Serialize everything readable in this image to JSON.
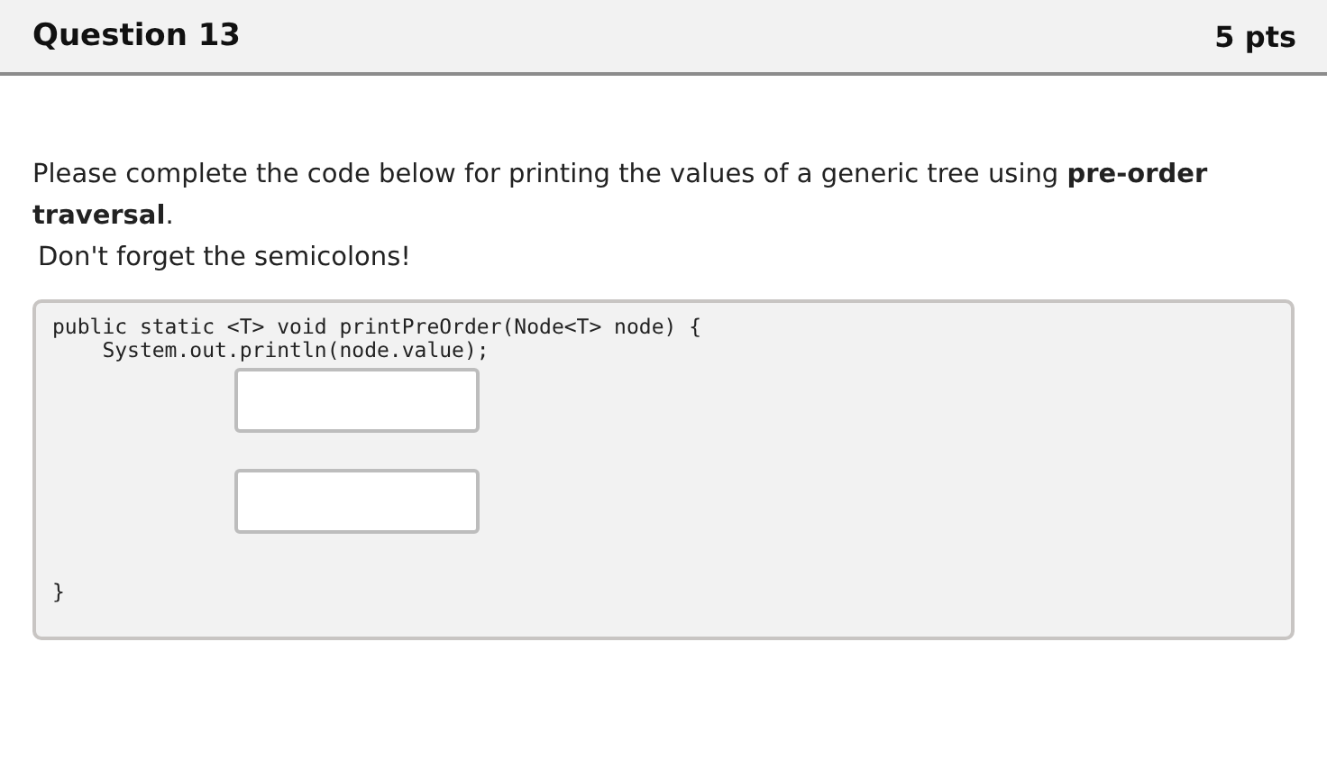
{
  "question": {
    "title": "Question 13",
    "points": "5 pts"
  },
  "prompt": "Please complete the code below for printing the values of a generic tree using **pre-order traversal**.",
  "note": "Don't forget the semicolons!",
  "code": [
    {
      "kind": "code",
      "text": "public static <T> void printPreOrder(Node<T> node) {"
    },
    {
      "kind": "code",
      "text": "    System.out.println(node.value);"
    },
    {
      "kind": "blank"
    },
    {
      "kind": "blank"
    },
    {
      "kind": "code",
      "text": "}"
    }
  ]
}
